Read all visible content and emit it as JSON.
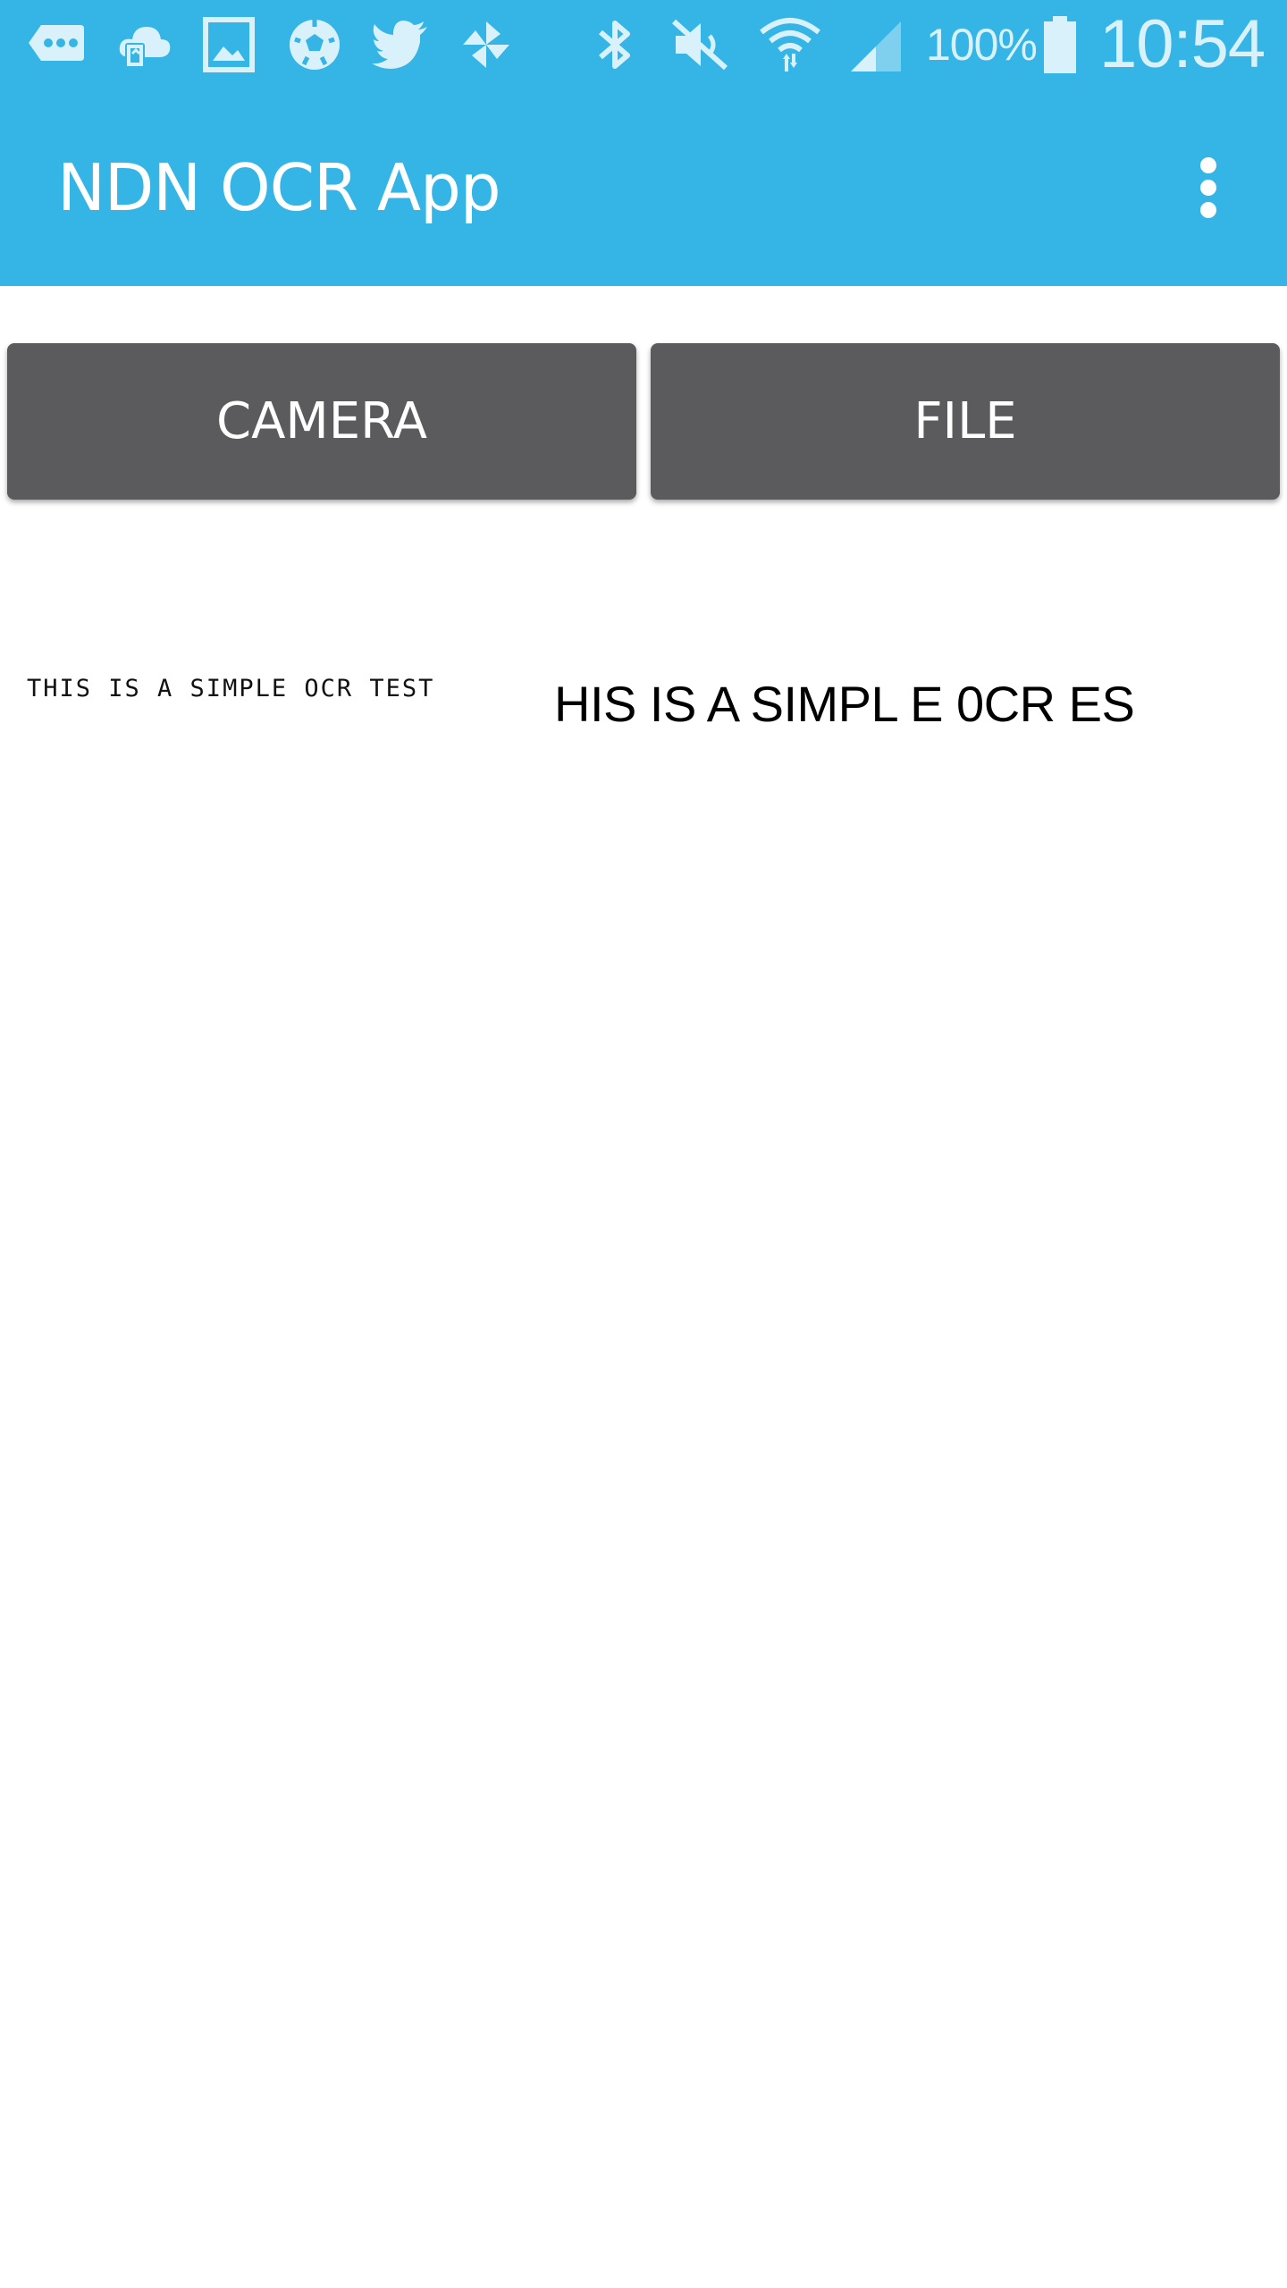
{
  "status_bar": {
    "background": "#34b5e5",
    "notification_icons": [
      "messenger-icon",
      "cloud-sync-icon",
      "gallery-icon",
      "soccer-ball-icon",
      "twitter-icon",
      "pinwheel-icon"
    ],
    "system_icons": [
      "bluetooth-icon",
      "mute-icon",
      "wifi-icon",
      "cell-signal-icon",
      "battery-icon"
    ],
    "battery_percent": "100%",
    "time": "10:54"
  },
  "toolbar": {
    "title": "NDN OCR App",
    "background": "#34b5e5",
    "overflow_icon": "more-vert-icon"
  },
  "buttons": {
    "camera_label": "CAMERA",
    "file_label": "FILE",
    "background": "#5b5b5d"
  },
  "content": {
    "source_image_text": "THIS IS A SIMPLE OCR TEST",
    "ocr_result": "HIS IS A SIMPL E 0CR ES"
  }
}
